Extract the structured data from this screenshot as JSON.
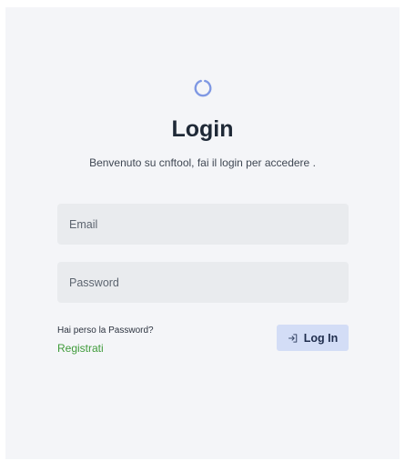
{
  "login": {
    "title": "Login",
    "subtitle": "Benvenuto su cnftool, fai il login per accedere .",
    "email_placeholder": "Email",
    "password_placeholder": "Password",
    "forgot_password": "Hai perso la Password?",
    "register": "Registrati",
    "login_button": "Log In"
  },
  "icons": {
    "logo": "loading-circle-icon",
    "login_button": "login-arrow-icon"
  },
  "colors": {
    "background": "#f4f5f8",
    "accent": "#7f98e3",
    "register_link": "#3f9b3a",
    "button_bg": "#d3ddf6"
  }
}
